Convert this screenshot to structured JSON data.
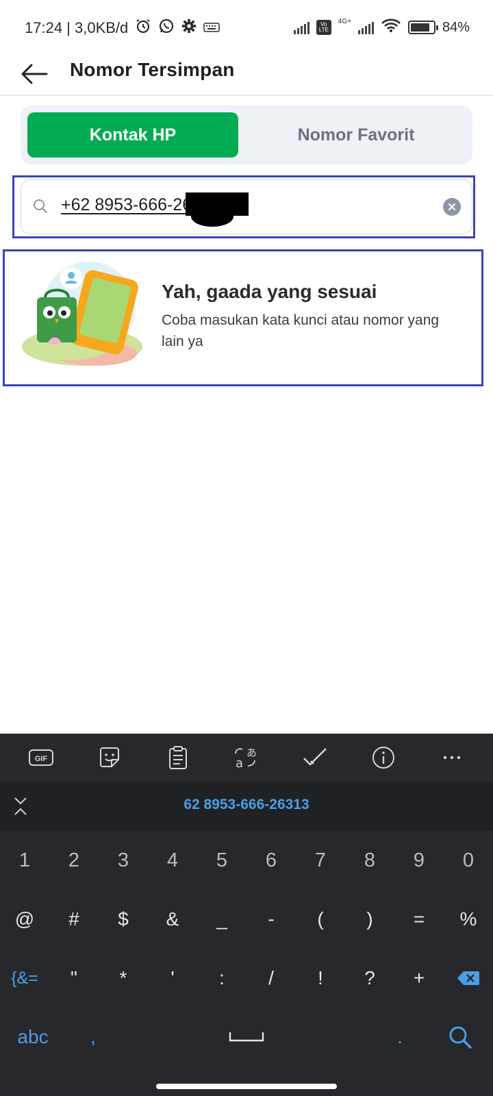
{
  "status_bar": {
    "time_speed": "17:24 | 3,0KB/d",
    "battery": "84%",
    "battery_level": 0.84,
    "network_label": "4G+",
    "volte_label": "Vo LTE"
  },
  "header": {
    "title": "Nomor Tersimpan"
  },
  "tabs": [
    {
      "label": "Kontak HP",
      "active": true
    },
    {
      "label": "Nomor Favorit",
      "active": false
    }
  ],
  "search": {
    "value": "+62 8953-666-26313"
  },
  "empty_state": {
    "title": "Yah, gaada yang sesuai",
    "description": "Coba masukan kata kunci atau nomor yang lain ya"
  },
  "keyboard": {
    "toolbar": [
      {
        "name": "gif-icon",
        "label": "GIF"
      },
      {
        "name": "sticker-icon"
      },
      {
        "name": "clipboard-icon"
      },
      {
        "name": "translate-icon"
      },
      {
        "name": "checkmark-icon"
      },
      {
        "name": "info-icon"
      },
      {
        "name": "more-icon",
        "label": "···"
      }
    ],
    "suggestion": "62 8953-666-26313",
    "row1": [
      "1",
      "2",
      "3",
      "4",
      "5",
      "6",
      "7",
      "8",
      "9",
      "0"
    ],
    "row2": [
      "@",
      "#",
      "$",
      "&",
      "_",
      "-",
      "(",
      ")",
      "=",
      "%"
    ],
    "row3": [
      "{&=",
      "\"",
      "*",
      "'",
      ":",
      "/",
      "!",
      "?",
      "+"
    ],
    "row4": {
      "abc": "abc",
      "comma": ",",
      "period": "."
    },
    "accent": "#4a9fe8"
  },
  "colors": {
    "brand_green": "#03ac52",
    "highlight_outline": "#3a44b7"
  }
}
